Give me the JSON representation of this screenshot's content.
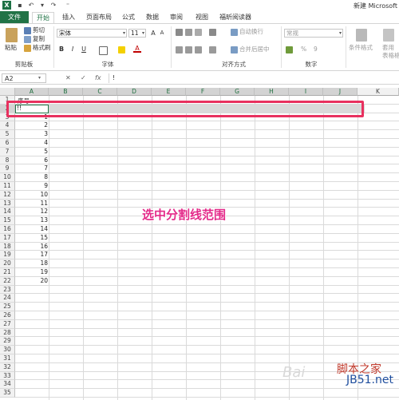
{
  "title_bar": {
    "app_logo": "X",
    "doc_title": "新建 Microsoft"
  },
  "tabs": [
    "文件",
    "开始",
    "插入",
    "页面布局",
    "公式",
    "数据",
    "审阅",
    "视图",
    "福昕阅读器"
  ],
  "ribbon": {
    "clipboard": {
      "paste": "粘贴",
      "cut": "剪切",
      "copy": "复制",
      "format_painter": "格式刷",
      "label": "剪贴板"
    },
    "font": {
      "name": "宋体",
      "size": "11",
      "bold": "B",
      "italic": "I",
      "underline": "U",
      "label": "字体"
    },
    "alignment": {
      "wrap": "自动换行",
      "merge": "合并后居中",
      "label": "对齐方式"
    },
    "number": {
      "format": "常规",
      "percent": "%",
      "comma": "9",
      "label": "数字"
    },
    "styles": {
      "conditional": "条件格式",
      "table": "套用\n表格格式"
    }
  },
  "formula_bar": {
    "name_box": "A2",
    "cancel": "✕",
    "enter": "✓",
    "fx": "fx",
    "content": "!"
  },
  "columns": [
    "A",
    "B",
    "C",
    "D",
    "E",
    "F",
    "G",
    "H",
    "I",
    "J",
    "K"
  ],
  "rows": [
    "1",
    "2",
    "3",
    "4",
    "5",
    "6",
    "7",
    "8",
    "9",
    "10",
    "11",
    "12",
    "13",
    "14",
    "15",
    "16",
    "17",
    "18",
    "19",
    "20",
    "21",
    "22",
    "23",
    "24",
    "25",
    "26",
    "27",
    "28",
    "29",
    "30",
    "31",
    "32",
    "33",
    "34",
    "35"
  ],
  "cells": {
    "a1": "序号",
    "a2": "!!",
    "values": [
      "1",
      "2",
      "3",
      "4",
      "5",
      "6",
      "7",
      "8",
      "9",
      "10",
      "11",
      "12",
      "13",
      "14",
      "15",
      "16",
      "17",
      "18",
      "19",
      "20"
    ]
  },
  "annotation": "选中分割线范围",
  "watermark": {
    "line1": "脚本之家",
    "line2": "JB51.net",
    "baidu": "Bai"
  }
}
